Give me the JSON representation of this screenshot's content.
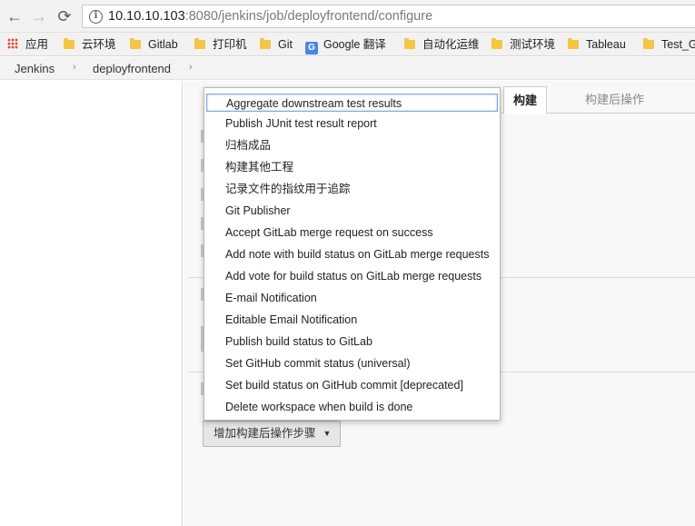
{
  "browser": {
    "url_host": "10.10.10.103",
    "url_rest": ":8080/jenkins/job/deployfrontend/configure",
    "nav": {
      "back": "←",
      "forward": "→",
      "reload": "⟳"
    },
    "bookmarks": [
      {
        "label": "应用",
        "icon": "apps-icon"
      },
      {
        "label": "云环境",
        "icon": "folder-icon"
      },
      {
        "label": "Gitlab",
        "icon": "folder-icon"
      },
      {
        "label": "打印机",
        "icon": "folder-icon"
      },
      {
        "label": "Git",
        "icon": "folder-icon"
      },
      {
        "label": "Google 翻译",
        "icon": "google-translate-icon"
      },
      {
        "label": "自动化运维",
        "icon": "folder-icon"
      },
      {
        "label": "测试环境",
        "icon": "folder-icon"
      },
      {
        "label": "Tableau",
        "icon": "folder-icon"
      },
      {
        "label": "Test_G",
        "icon": "folder-icon"
      }
    ]
  },
  "breadcrumb": {
    "items": [
      "Jenkins",
      "deployfrontend"
    ],
    "separator": "›"
  },
  "tabs": {
    "build": "构建",
    "post_build": "构建后操作"
  },
  "add_post_build_button": {
    "label": "增加构建后操作步骤",
    "caret": "▼"
  },
  "dropdown": {
    "items": [
      "Aggregate downstream test results",
      "Publish JUnit test result report",
      "归档成品",
      "构建其他工程",
      "记录文件的指纹用于追踪",
      "Git Publisher",
      "Accept GitLab merge request on success",
      "Add note with build status on GitLab merge requests",
      "Add vote for build status on GitLab merge requests",
      "E-mail Notification",
      "Editable Email Notification",
      "Publish build status to GitLab",
      "Set GitHub commit status (universal)",
      "Set build status on GitHub commit [deprecated]",
      "Delete workspace when build is done"
    ],
    "selected_index": 0
  },
  "colors": {
    "selection_border": "#7fa7e0",
    "folder": "#f6c544"
  }
}
